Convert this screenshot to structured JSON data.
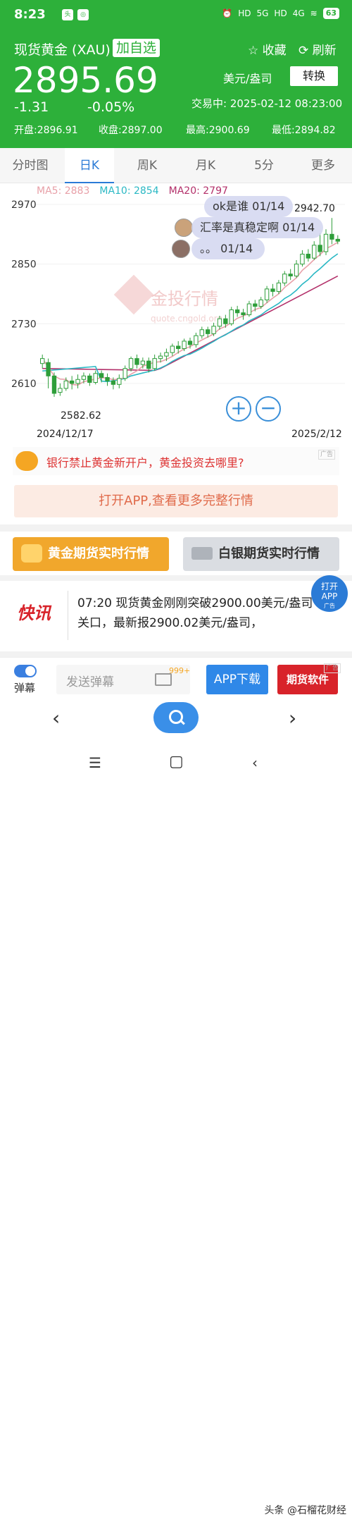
{
  "status": {
    "time": "8:23",
    "app1": "头",
    "app2": "◎",
    "hd1": "HD",
    "net1": "5G",
    "hd2": "HD",
    "net2": "4G",
    "battery": "63"
  },
  "header": {
    "name": "现货黄金 (XAU)",
    "add": "加自选",
    "fav": "☆ 收藏",
    "refresh": "⟳ 刷新",
    "price": "2895.69",
    "unit": "美元/盎司",
    "convert": "转换",
    "change": "-1.31",
    "pct": "-0.05%",
    "trade": "交易中: 2025-02-12 08:23:00",
    "open": "开盘:2896.91",
    "close": "收盘:2897.00",
    "high": "最高:2900.69",
    "low": "最低:2894.82"
  },
  "tabs": [
    "分时图",
    "日K",
    "周K",
    "月K",
    "5分",
    "更多"
  ],
  "chart_data": {
    "type": "candlestick",
    "ma": {
      "ma5": "MA5: 2883",
      "ma10": "MA10: 2854",
      "ma20": "MA20: 2797"
    },
    "colors": {
      "up": "#2e9e3a",
      "up_fill": "#ffffff",
      "down": "#2e9e3a",
      "ma5": "#e8a0a8",
      "ma10": "#2ab8c4",
      "ma20": "#b3306a"
    },
    "y_ticks": [
      "2970",
      "2850",
      "2730",
      "2610"
    ],
    "ylim": [
      2570,
      2990
    ],
    "x_labels": [
      "2024/12/17",
      "2025/2/12"
    ],
    "max_label": "2942.70",
    "min_label": "2582.62",
    "candles": [
      [
        2650,
        2660,
        2640,
        2668
      ],
      [
        2652,
        2625,
        2600,
        2660
      ],
      [
        2625,
        2590,
        2583,
        2632
      ],
      [
        2592,
        2600,
        2585,
        2610
      ],
      [
        2600,
        2615,
        2595,
        2622
      ],
      [
        2615,
        2610,
        2598,
        2625
      ],
      [
        2610,
        2618,
        2600,
        2628
      ],
      [
        2618,
        2625,
        2610,
        2632
      ],
      [
        2625,
        2612,
        2605,
        2630
      ],
      [
        2612,
        2630,
        2608,
        2636
      ],
      [
        2630,
        2622,
        2612,
        2636
      ],
      [
        2622,
        2615,
        2605,
        2630
      ],
      [
        2615,
        2608,
        2598,
        2622
      ],
      [
        2608,
        2620,
        2600,
        2628
      ],
      [
        2620,
        2640,
        2615,
        2646
      ],
      [
        2640,
        2660,
        2634,
        2664
      ],
      [
        2660,
        2648,
        2640,
        2668
      ],
      [
        2648,
        2655,
        2640,
        2662
      ],
      [
        2655,
        2640,
        2632,
        2662
      ],
      [
        2640,
        2660,
        2636,
        2668
      ],
      [
        2660,
        2665,
        2652,
        2672
      ],
      [
        2665,
        2672,
        2655,
        2680
      ],
      [
        2672,
        2685,
        2665,
        2690
      ],
      [
        2685,
        2680,
        2670,
        2695
      ],
      [
        2680,
        2695,
        2675,
        2700
      ],
      [
        2695,
        2688,
        2680,
        2702
      ],
      [
        2688,
        2706,
        2682,
        2712
      ],
      [
        2706,
        2718,
        2700,
        2724
      ],
      [
        2718,
        2710,
        2702,
        2724
      ],
      [
        2710,
        2725,
        2705,
        2732
      ],
      [
        2725,
        2740,
        2718,
        2746
      ],
      [
        2740,
        2730,
        2722,
        2748
      ],
      [
        2730,
        2758,
        2726,
        2764
      ],
      [
        2758,
        2752,
        2744,
        2766
      ],
      [
        2752,
        2748,
        2738,
        2760
      ],
      [
        2748,
        2770,
        2744,
        2776
      ],
      [
        2770,
        2765,
        2755,
        2778
      ],
      [
        2765,
        2778,
        2760,
        2784
      ],
      [
        2778,
        2800,
        2772,
        2806
      ],
      [
        2800,
        2795,
        2785,
        2810
      ],
      [
        2795,
        2812,
        2790,
        2818
      ],
      [
        2812,
        2830,
        2806,
        2836
      ],
      [
        2830,
        2826,
        2818,
        2840
      ],
      [
        2826,
        2850,
        2822,
        2858
      ],
      [
        2850,
        2870,
        2845,
        2878
      ],
      [
        2870,
        2862,
        2855,
        2880
      ],
      [
        2862,
        2888,
        2858,
        2896
      ],
      [
        2888,
        2875,
        2866,
        2912
      ],
      [
        2875,
        2910,
        2868,
        2920
      ],
      [
        2910,
        2900,
        2890,
        2942.7
      ],
      [
        2900,
        2896,
        2890,
        2908
      ]
    ]
  },
  "danmu": [
    {
      "text": "ok是谁 01/14"
    },
    {
      "text": "汇率是真稳定啊 01/14"
    },
    {
      "text": "。。 01/14"
    }
  ],
  "watermark_site": "金投行情",
  "watermark_url": "quote.cngold.org",
  "ad1": {
    "text": "银行禁止黄金新开户，黄金投资去哪里?",
    "tag": "广告"
  },
  "open_app": "打开APP,查看更多完整行情",
  "gold_btn": "黄金期货实时行情",
  "silver_btn": "白银期货实时行情",
  "news": {
    "tag": "快讯",
    "body": "07:20  现货黄金刚刚突破2900.00美元/盎司关口，最新报2900.02美元/盎司，"
  },
  "float_app": {
    "line1": "打开",
    "line2": "APP",
    "tag": "广告"
  },
  "bottom": {
    "danmu_label": "弹幕",
    "send_placeholder": "发送弹幕",
    "badge": "999+",
    "download": "APP下载",
    "futures": "期货软件",
    "tag": "广告"
  },
  "footer_credit": "头条 @石榴花财经"
}
